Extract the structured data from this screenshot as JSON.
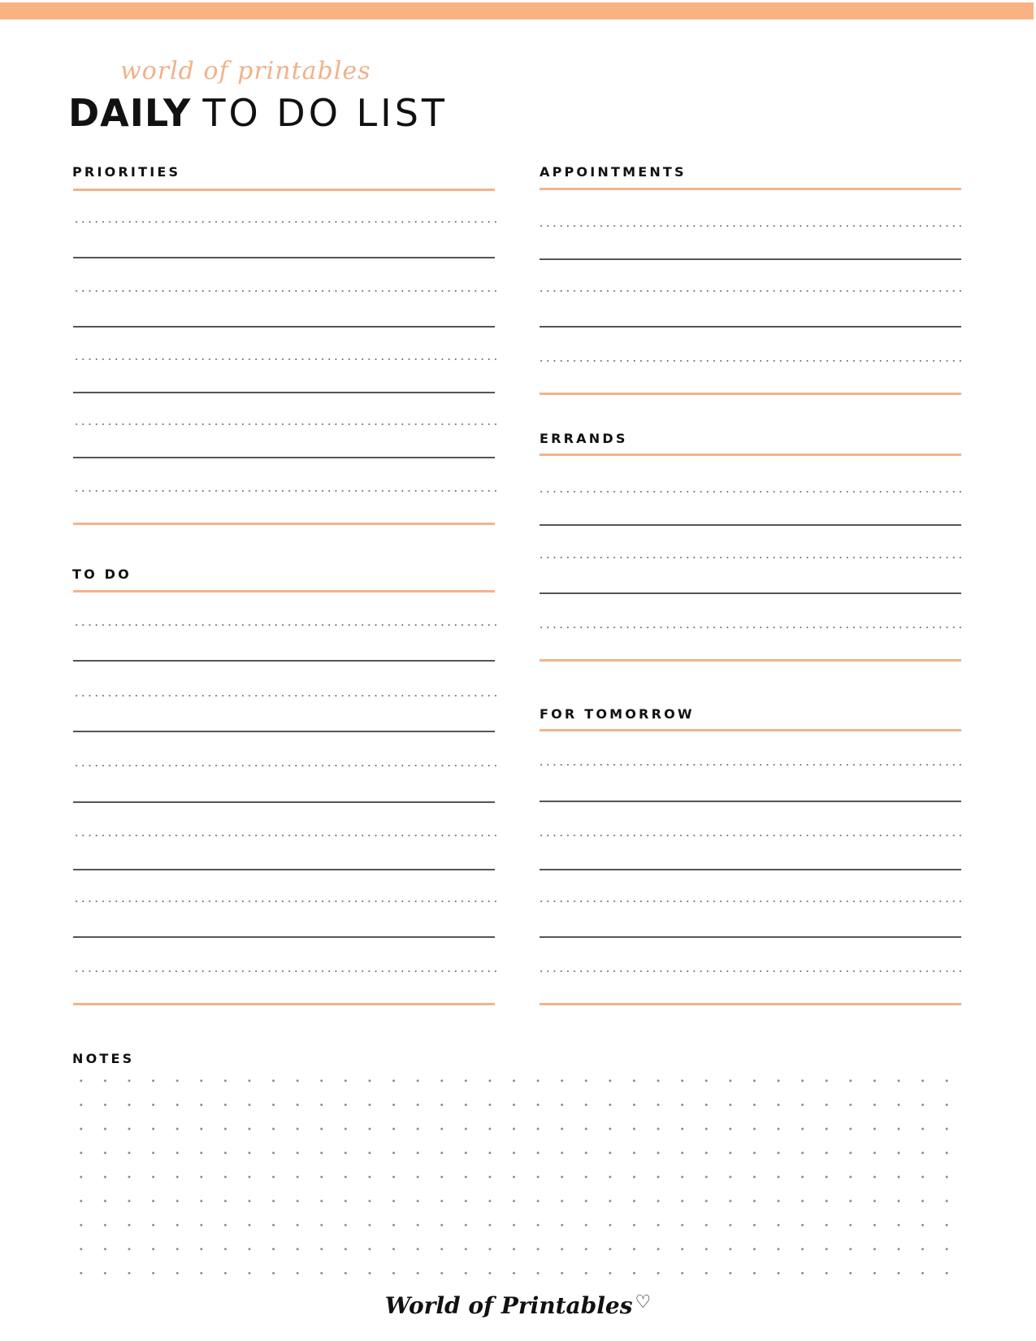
{
  "header": {
    "brand_script": "world of printables",
    "title_bold": "DAILY",
    "title_light": "TO DO LIST"
  },
  "colors": {
    "accent": "#f9b383",
    "rule_accent": "#f2b48a",
    "text": "#111111"
  },
  "sections": {
    "priorities": {
      "label": "PRIORITIES",
      "lines": 5
    },
    "todo": {
      "label": "TO DO",
      "lines": 6
    },
    "appointments": {
      "label": "APPOINTMENTS",
      "lines": 3
    },
    "errands": {
      "label": "ERRANDS",
      "lines": 3
    },
    "for_tomorrow": {
      "label": "FOR TOMORROW",
      "lines": 4
    },
    "notes": {
      "label": "NOTES",
      "dot_rows": 9,
      "dot_cols": 38
    }
  },
  "footer": {
    "brand": "World of Printables",
    "heart_icon": "heart-outline-icon"
  }
}
